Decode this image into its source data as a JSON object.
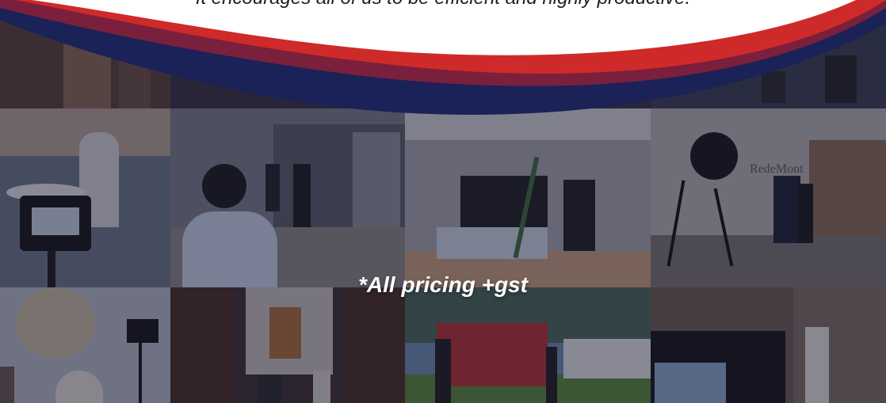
{
  "banner": {
    "quote": "It encourages all of us to be efficient and highly productive."
  },
  "pricing_note": "*All pricing +gst",
  "photos": {
    "office_sign": "RedeMont",
    "colors": {
      "red_band": "#cf2a2a",
      "navy_band": "#1a2257",
      "overlay": "#161630"
    }
  }
}
